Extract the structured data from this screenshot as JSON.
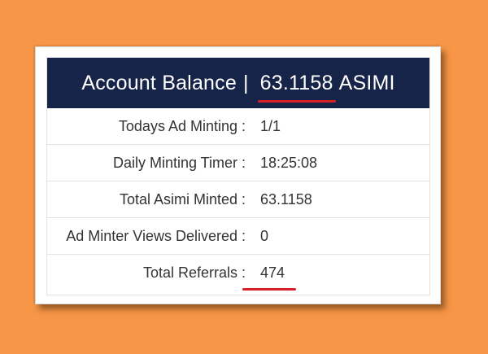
{
  "balance": {
    "title": "Account Balance",
    "separator": "|",
    "value": "63.1158",
    "currency": "ASIMI"
  },
  "stats": [
    {
      "label": "Todays Ad Minting :",
      "value": "1/1",
      "highlighted": false
    },
    {
      "label": "Daily Minting Timer :",
      "value": "18:25:08",
      "highlighted": false
    },
    {
      "label": "Total Asimi Minted :",
      "value": "63.1158",
      "highlighted": false
    },
    {
      "label": "Ad Minter Views Delivered :",
      "value": "0",
      "highlighted": false
    },
    {
      "label": "Total Referrals :",
      "value": "474",
      "highlighted": true
    }
  ],
  "colors": {
    "background": "#f79646",
    "header": "#172449",
    "highlight_underline": "#d8202a"
  }
}
